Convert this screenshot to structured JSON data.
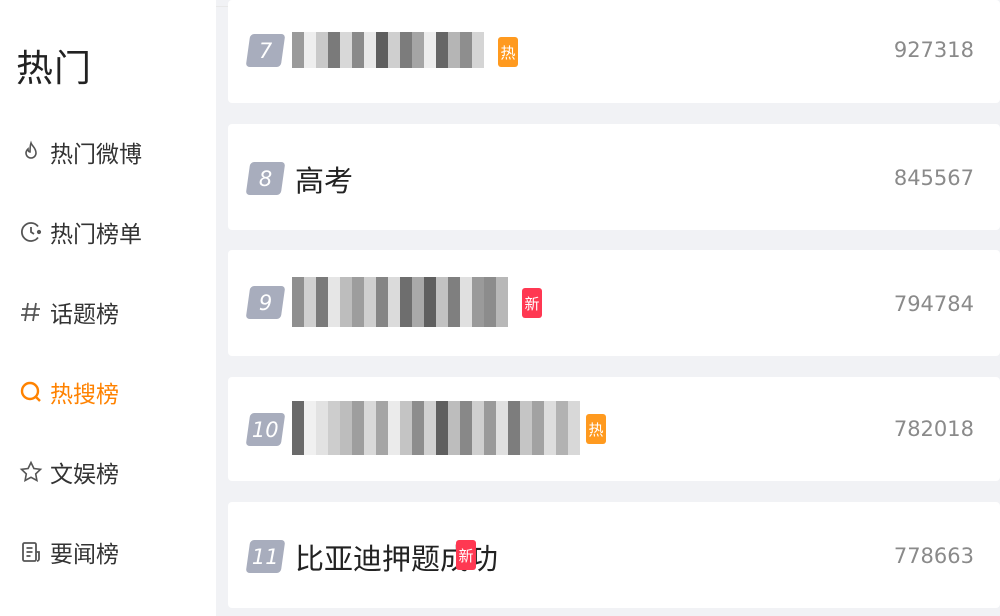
{
  "sidebar": {
    "title": "热门",
    "items": [
      {
        "label": "热门微博",
        "icon": "flame-icon",
        "active": false
      },
      {
        "label": "热门榜单",
        "icon": "clock-icon",
        "active": false
      },
      {
        "label": "话题榜",
        "icon": "hashtag-icon",
        "active": false
      },
      {
        "label": "热搜榜",
        "icon": "search-icon",
        "active": true
      },
      {
        "label": "文娱榜",
        "icon": "star-icon",
        "active": false
      },
      {
        "label": "要闻榜",
        "icon": "document-icon",
        "active": false
      }
    ]
  },
  "colors": {
    "accent": "#ff8200",
    "rank_badge": "#a8adbd",
    "hot_tag": "#ff9a1f",
    "new_tag": "#ff3852"
  },
  "list": [
    {
      "rank": "7",
      "title": "",
      "blurred": true,
      "tag": "热",
      "tag_type": "hot",
      "count": "927318"
    },
    {
      "rank": "8",
      "title": "高考",
      "blurred": false,
      "tag": "",
      "tag_type": "",
      "count": "845567"
    },
    {
      "rank": "9",
      "title": "",
      "blurred": true,
      "tag": "新",
      "tag_type": "new",
      "count": "794784"
    },
    {
      "rank": "10",
      "title": "",
      "blurred": true,
      "tag": "热",
      "tag_type": "hot",
      "count": "782018"
    },
    {
      "rank": "11",
      "title": "比亚迪押题成功",
      "blurred": false,
      "tag": "新",
      "tag_type": "new",
      "count": "778663"
    }
  ]
}
